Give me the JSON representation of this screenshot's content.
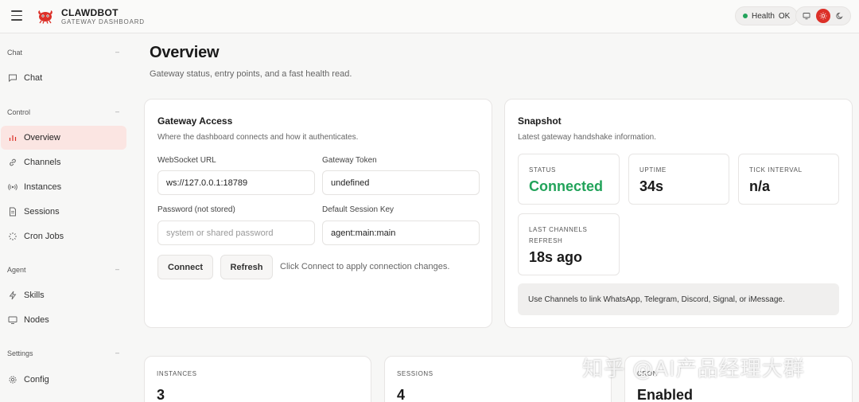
{
  "header": {
    "brand_title": "CLAWDBOT",
    "brand_subtitle": "GATEWAY DASHBOARD",
    "health_label": "Health",
    "health_status": "OK"
  },
  "sidebar": {
    "sections": [
      {
        "label": "Chat",
        "items": [
          {
            "label": "Chat",
            "icon": "chat-bubble-icon"
          }
        ]
      },
      {
        "label": "Control",
        "items": [
          {
            "label": "Overview",
            "icon": "bar-chart-icon",
            "active": true
          },
          {
            "label": "Channels",
            "icon": "link-icon"
          },
          {
            "label": "Instances",
            "icon": "broadcast-icon"
          },
          {
            "label": "Sessions",
            "icon": "document-icon"
          },
          {
            "label": "Cron Jobs",
            "icon": "loader-icon"
          }
        ]
      },
      {
        "label": "Agent",
        "items": [
          {
            "label": "Skills",
            "icon": "lightning-icon"
          },
          {
            "label": "Nodes",
            "icon": "monitor-icon"
          }
        ]
      },
      {
        "label": "Settings",
        "items": [
          {
            "label": "Config",
            "icon": "gear-icon"
          }
        ]
      }
    ]
  },
  "main": {
    "title": "Overview",
    "subtitle": "Gateway status, entry points, and a fast health read."
  },
  "gateway": {
    "title": "Gateway Access",
    "subtitle": "Where the dashboard connects and how it authenticates.",
    "ws_label": "WebSocket URL",
    "ws_value": "ws://127.0.0.1:18789",
    "token_label": "Gateway Token",
    "token_value": "undefined",
    "password_label": "Password (not stored)",
    "password_placeholder": "system or shared password",
    "session_label": "Default Session Key",
    "session_value": "agent:main:main",
    "connect_label": "Connect",
    "refresh_label": "Refresh",
    "hint": "Click Connect to apply connection changes."
  },
  "snapshot": {
    "title": "Snapshot",
    "subtitle": "Latest gateway handshake information.",
    "status_label": "STATUS",
    "status_value": "Connected",
    "uptime_label": "UPTIME",
    "uptime_value": "34s",
    "tick_label": "TICK INTERVAL",
    "tick_value": "n/a",
    "refresh_label_1": "LAST CHANNELS",
    "refresh_label_2": "REFRESH",
    "refresh_value": "18s ago",
    "notice": "Use Channels to link WhatsApp, Telegram, Discord, Signal, or iMessage."
  },
  "stats": {
    "instances_label": "INSTANCES",
    "instances_value": "3",
    "sessions_label": "SESSIONS",
    "sessions_value": "4",
    "cron_label": "CRON",
    "cron_value": "Enabled"
  },
  "watermark": "知乎 @AI产品经理大群",
  "colors": {
    "accent": "#dc2f27",
    "ok": "#22a35a",
    "active_nav_bg": "#fbe5e2"
  }
}
